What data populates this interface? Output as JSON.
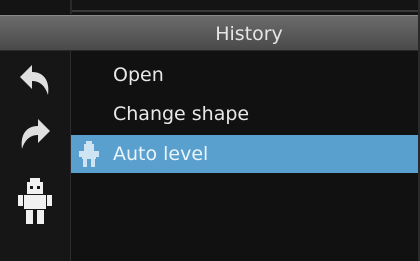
{
  "panel": {
    "title": "History"
  },
  "toolbar": {
    "tools": [
      {
        "name": "undo",
        "icon": "undo-arrow-icon"
      },
      {
        "name": "redo",
        "icon": "redo-arrow-icon"
      },
      {
        "name": "robot",
        "icon": "robot-icon"
      }
    ]
  },
  "history": {
    "items": [
      {
        "label": "Open",
        "selected": false
      },
      {
        "label": "Change shape",
        "selected": false
      },
      {
        "label": "Auto level",
        "selected": true,
        "icon": "robot-icon"
      }
    ]
  },
  "colors": {
    "selection": "#5aa0ce",
    "header": "#5a5a5a",
    "background": "#111111",
    "text": "#e8e8e8"
  }
}
